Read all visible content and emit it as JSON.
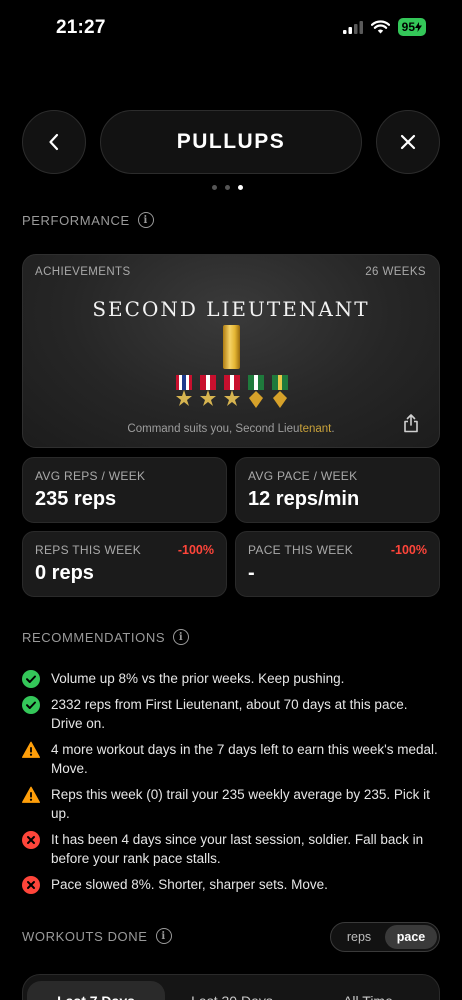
{
  "status": {
    "time": "21:27",
    "battery": "95"
  },
  "header": {
    "title": "PULLUPS"
  },
  "pager": {
    "count": 3,
    "active": 2
  },
  "performance": {
    "title": "PERFORMANCE",
    "achievement": {
      "label": "ACHIEVEMENTS",
      "weeks": "26 WEEKS",
      "rank": "SECOND LIEUTENANT",
      "caption_prefix": "Command suits you, Second Lieu",
      "caption_highlight": "tenant",
      "caption_suffix": "."
    },
    "stats": {
      "avg_reps": {
        "label": "AVG REPS / WEEK",
        "value": "235 reps"
      },
      "avg_pace": {
        "label": "AVG PACE / WEEK",
        "value": "12 reps/min"
      },
      "reps_week": {
        "label": "REPS THIS WEEK",
        "value": "0 reps",
        "delta": "-100%"
      },
      "pace_week": {
        "label": "PACE THIS WEEK",
        "value": "-",
        "delta": "-100%"
      }
    }
  },
  "recommendations": {
    "title": "RECOMMENDATIONS",
    "items": [
      {
        "status": "success",
        "text": "Volume up 8% vs the prior weeks. Keep pushing."
      },
      {
        "status": "success",
        "text": "2332 reps from First Lieutenant, about 70 days at this pace. Drive on."
      },
      {
        "status": "warning",
        "text": "4 more workout days in the 7 days left to earn this week's medal. Move."
      },
      {
        "status": "warning",
        "text": "Reps this week (0) trail your 235 weekly average by 235. Pick it up."
      },
      {
        "status": "error",
        "text": "It has been 4 days since your last session, soldier. Fall back in before your rank pace stalls."
      },
      {
        "status": "error",
        "text": "Pace slowed 8%. Shorter, sharper sets. Move."
      }
    ]
  },
  "workouts": {
    "title": "WORKOUTS DONE",
    "toggle": {
      "reps": "reps",
      "pace": "pace",
      "selected": "pace"
    },
    "ranges": {
      "last7": "Last 7 Days",
      "last30": "Last 30 Days",
      "all": "All Time",
      "selected": "last7"
    }
  },
  "colors": {
    "success": "#34c759",
    "warning": "#ff9f0a",
    "error": "#ff453a",
    "gold": "#e4b533"
  }
}
